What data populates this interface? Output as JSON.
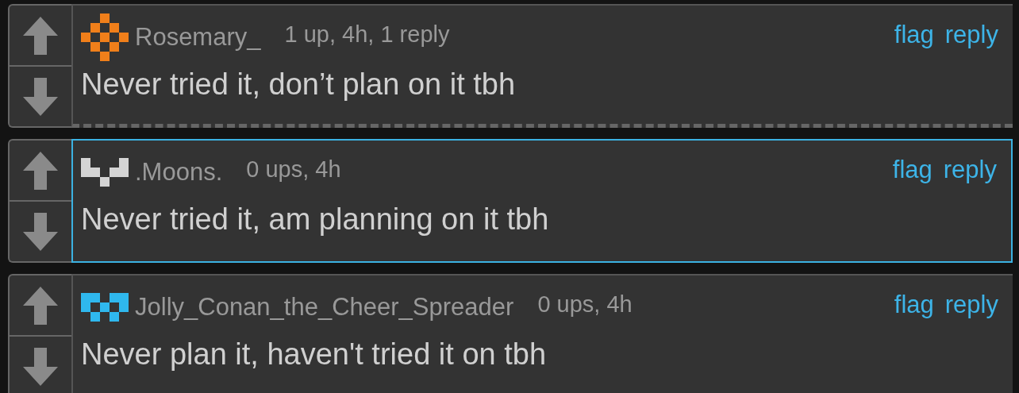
{
  "comments": [
    {
      "username": "Rosemary_",
      "color": "#f07f1a",
      "meta": "1 up, 4h, 1 reply",
      "text": "Never tried it, don’t plan on it tbh",
      "highlighted": false,
      "collapsed_replies": true,
      "actions": [
        "flag",
        "reply"
      ]
    },
    {
      "username": ".Moons.",
      "color": "#d4d4d4",
      "meta": "0 ups, 4h",
      "text": "Never tried it, am planning on it tbh",
      "highlighted": true,
      "collapsed_replies": false,
      "actions": [
        "flag",
        "reply"
      ]
    },
    {
      "username": "Jolly_Conan_the_Cheer_Spreader",
      "color": "#2fb8ee",
      "meta": "0 ups, 4h",
      "text": "Never plan it, haven't tried it on tbh",
      "highlighted": false,
      "actions": [
        "flag",
        "reply"
      ]
    }
  ]
}
